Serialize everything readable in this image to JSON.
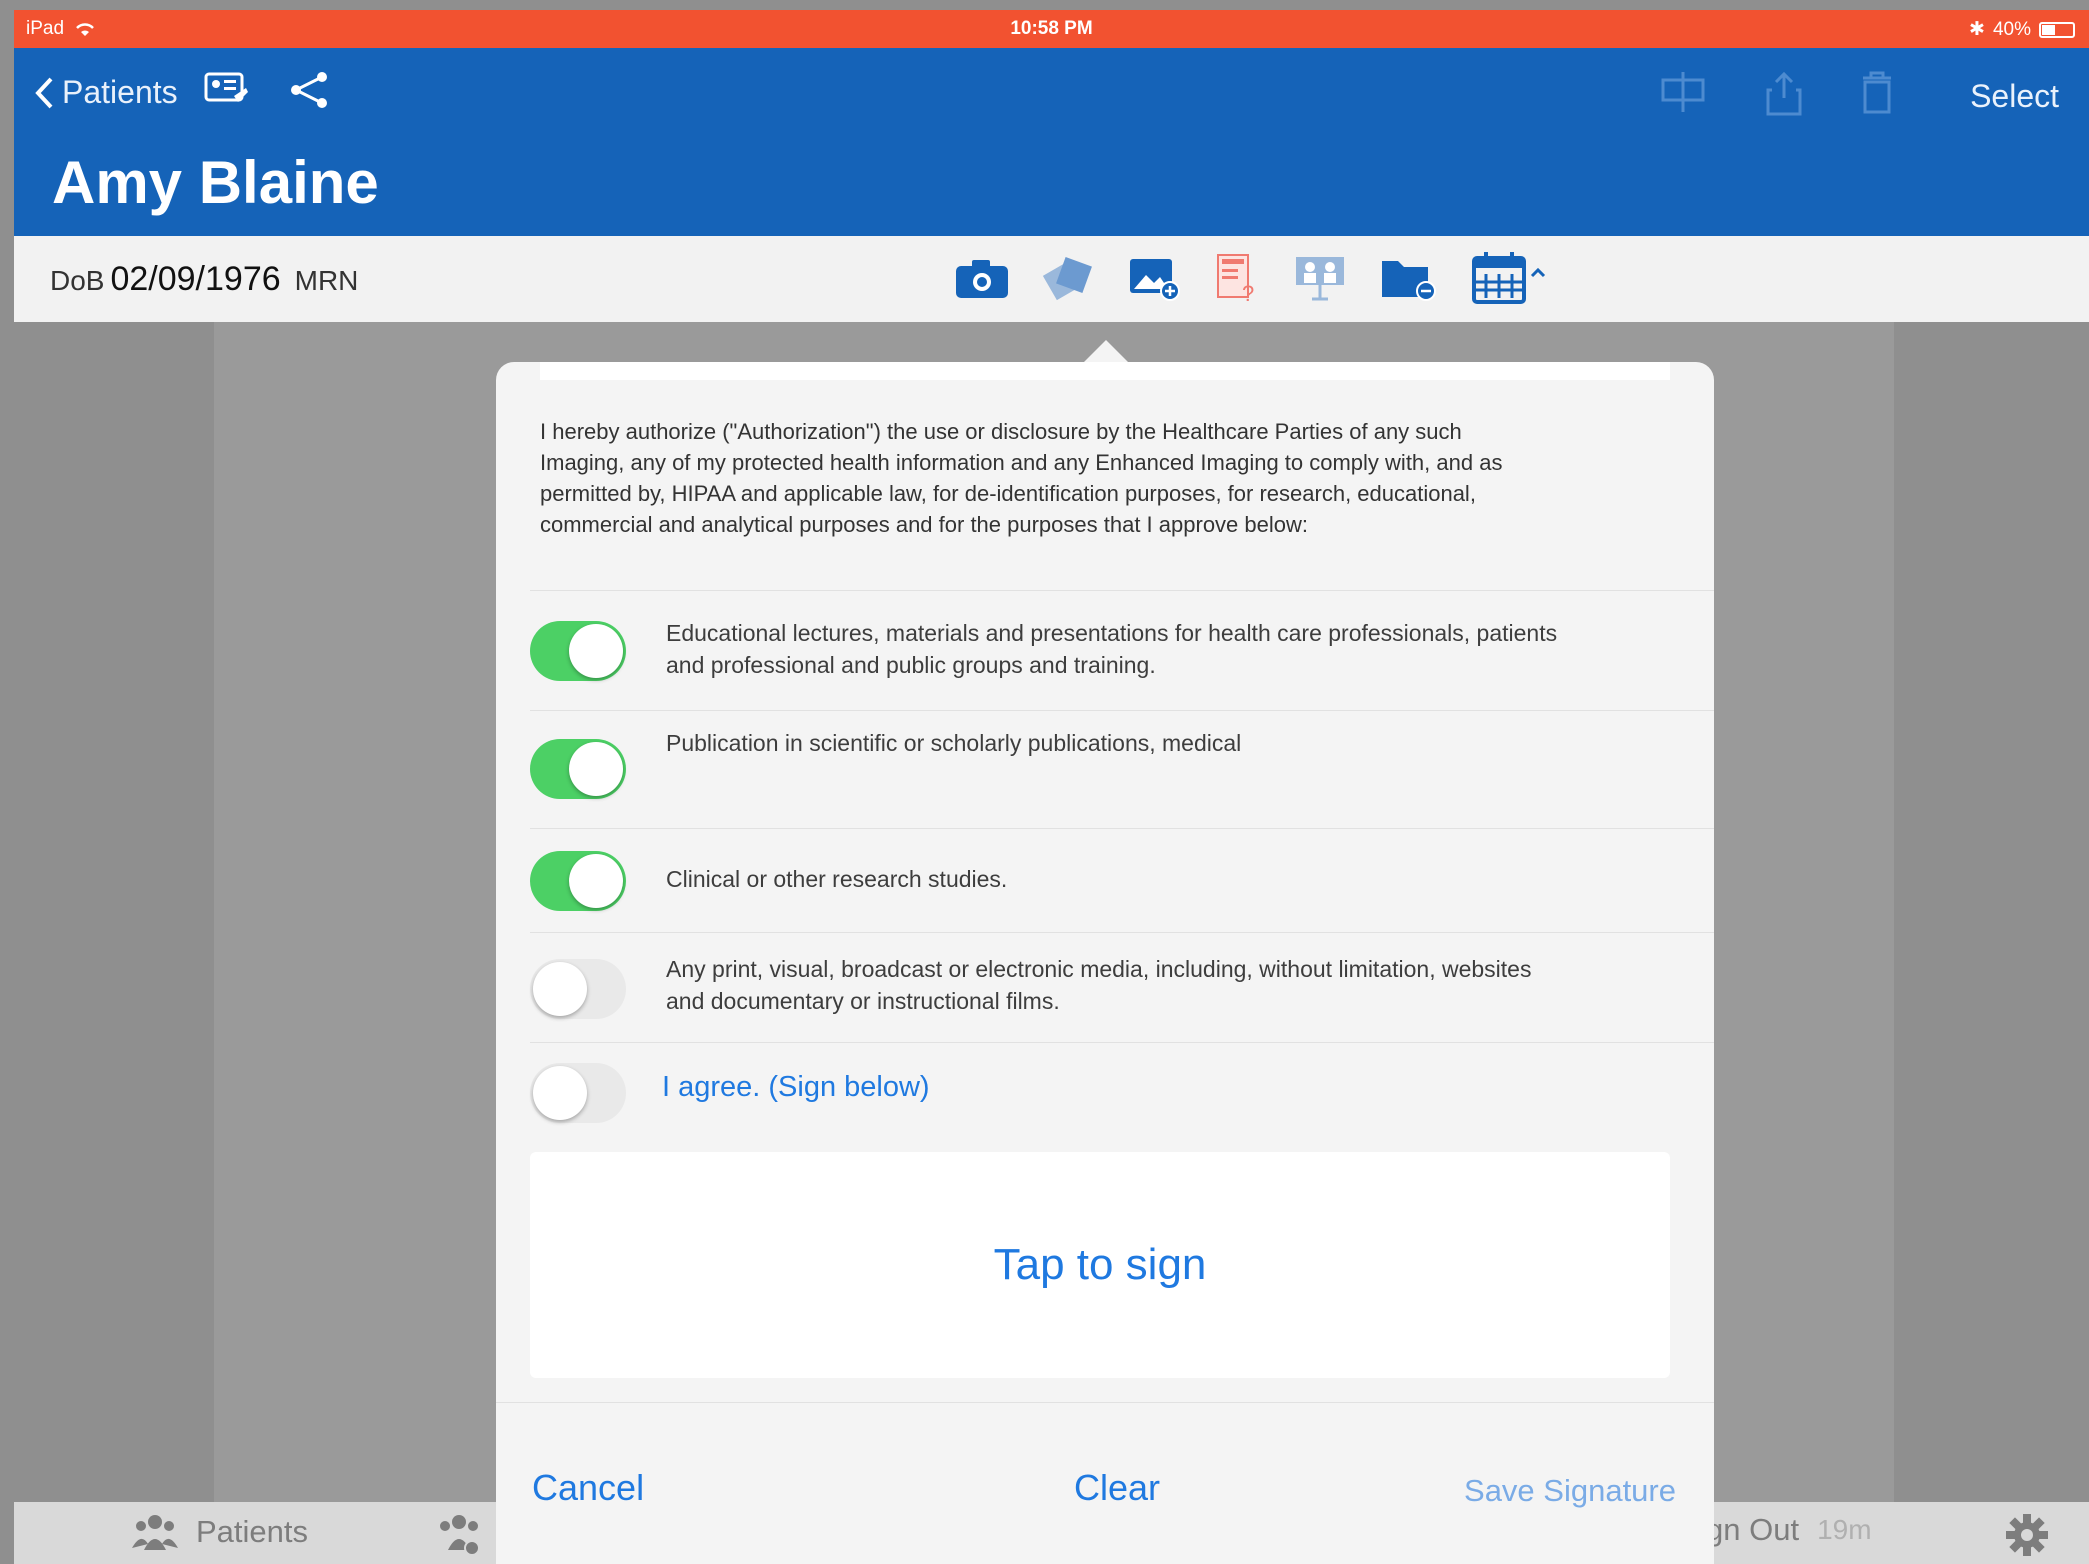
{
  "status_bar": {
    "device": "iPad",
    "time": "10:58 PM",
    "battery": "40%"
  },
  "nav": {
    "back_label": "Patients",
    "title": "Amy Blaine",
    "select_label": "Select"
  },
  "patient": {
    "dob_label": "DoB",
    "dob_value": "02/09/1976",
    "mrn_label": "MRN"
  },
  "tab_bar": {
    "patients_label": "Patients",
    "signout_label": "gn Out",
    "signout_timer": "19m"
  },
  "consent": {
    "authorization_text": "I hereby authorize (\"Authorization\") the use or disclosure by the Healthcare Parties of any such Imaging, any of my protected health information and any Enhanced Imaging to comply with, and as permitted by, HIPAA and applicable law, for de-identification purposes, for research, educational, commercial and analytical purposes and for the purposes that I approve below:",
    "options": [
      {
        "label": "Educational lectures, materials and presentations for health care professionals, patients and professional and public groups and training.",
        "enabled": true
      },
      {
        "label": "Publication in scientific or scholarly publications, medical",
        "enabled": true
      },
      {
        "label": "Clinical or other research studies.",
        "enabled": true
      },
      {
        "label": "Any print, visual, broadcast or electronic media, including, without limitation, websites and documentary or instructional films.",
        "enabled": false
      }
    ],
    "agree_label": "I agree. (Sign below)",
    "agree_enabled": false,
    "sign_prompt": "Tap to sign",
    "cancel_label": "Cancel",
    "clear_label": "Clear",
    "save_label": "Save Signature"
  },
  "colors": {
    "status_bar": "#f25230",
    "nav_bar": "#1563b8",
    "toggle_on": "#4cd065",
    "link": "#1f79e0"
  }
}
